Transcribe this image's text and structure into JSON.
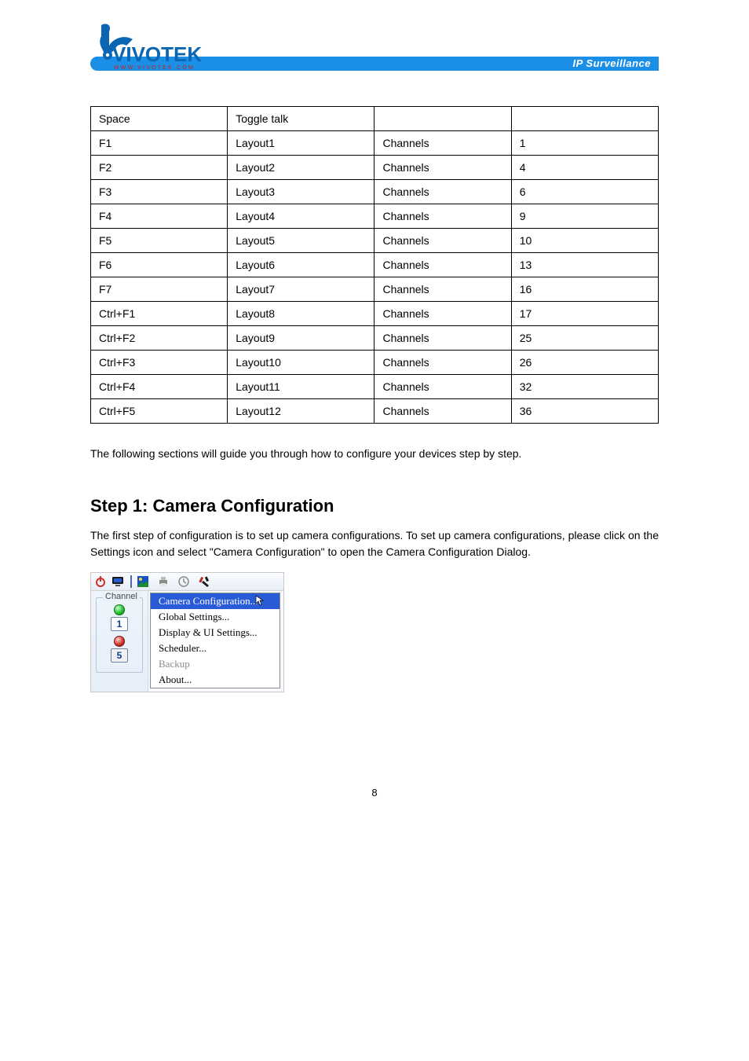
{
  "banner": {
    "brand_primary": "VIVOTEK",
    "brand_sub": "WWW.VIVOTEK.COM",
    "right": "IP Surveillance"
  },
  "table": {
    "headers": {
      "c3": "Channels",
      "c3b": "Channels"
    },
    "rows": [
      {
        "code": "Space",
        "name": "Toggle talk",
        "lbl": "",
        "ch": ""
      },
      {
        "code": "F1",
        "name": "Layout1",
        "lbl": "Channels",
        "ch": "1"
      },
      {
        "code": "F2",
        "name": "Layout2",
        "lbl": "Channels",
        "ch": "4"
      },
      {
        "code": "F3",
        "name": "Layout3",
        "lbl": "Channels",
        "ch": "6"
      },
      {
        "code": "F4",
        "name": "Layout4",
        "lbl": "Channels",
        "ch": "9"
      },
      {
        "code": "F5",
        "name": "Layout5",
        "lbl": "Channels",
        "ch": "10"
      },
      {
        "code": "F6",
        "name": "Layout6",
        "lbl": "Channels",
        "ch": "13"
      },
      {
        "code": "F7",
        "name": "Layout7",
        "lbl": "Channels",
        "ch": "16"
      },
      {
        "code": "Ctrl+F1",
        "name": "Layout8",
        "lbl": "Channels",
        "ch": "17"
      },
      {
        "code": "Ctrl+F2",
        "name": "Layout9",
        "lbl": "Channels",
        "ch": "25"
      },
      {
        "code": "Ctrl+F3",
        "name": "Layout10",
        "lbl": "Channels",
        "ch": "26"
      },
      {
        "code": "Ctrl+F4",
        "name": "Layout11",
        "lbl": "Channels",
        "ch": "32"
      },
      {
        "code": "Ctrl+F5",
        "name": "Layout12",
        "lbl": "Channels",
        "ch": "36"
      }
    ]
  },
  "para": "The following sections will guide you through how to configure your devices step by step.",
  "step_heading": "Step 1: Camera Configuration",
  "step_para": "The first step of configuration is to set up camera configurations. To set up camera configurations, please click on the Settings icon and select \"Camera Configuration\" to open the Camera Configuration Dialog.",
  "shot": {
    "panel_legend": "Channel",
    "ch1": "1",
    "ch5": "5",
    "menu": {
      "camera_configuration": "Camera Configuration...",
      "global_settings": "Global Settings...",
      "display_ui_settings": "Display & UI Settings...",
      "scheduler": "Scheduler...",
      "backup": "Backup",
      "about": "About..."
    }
  },
  "footer": "8"
}
